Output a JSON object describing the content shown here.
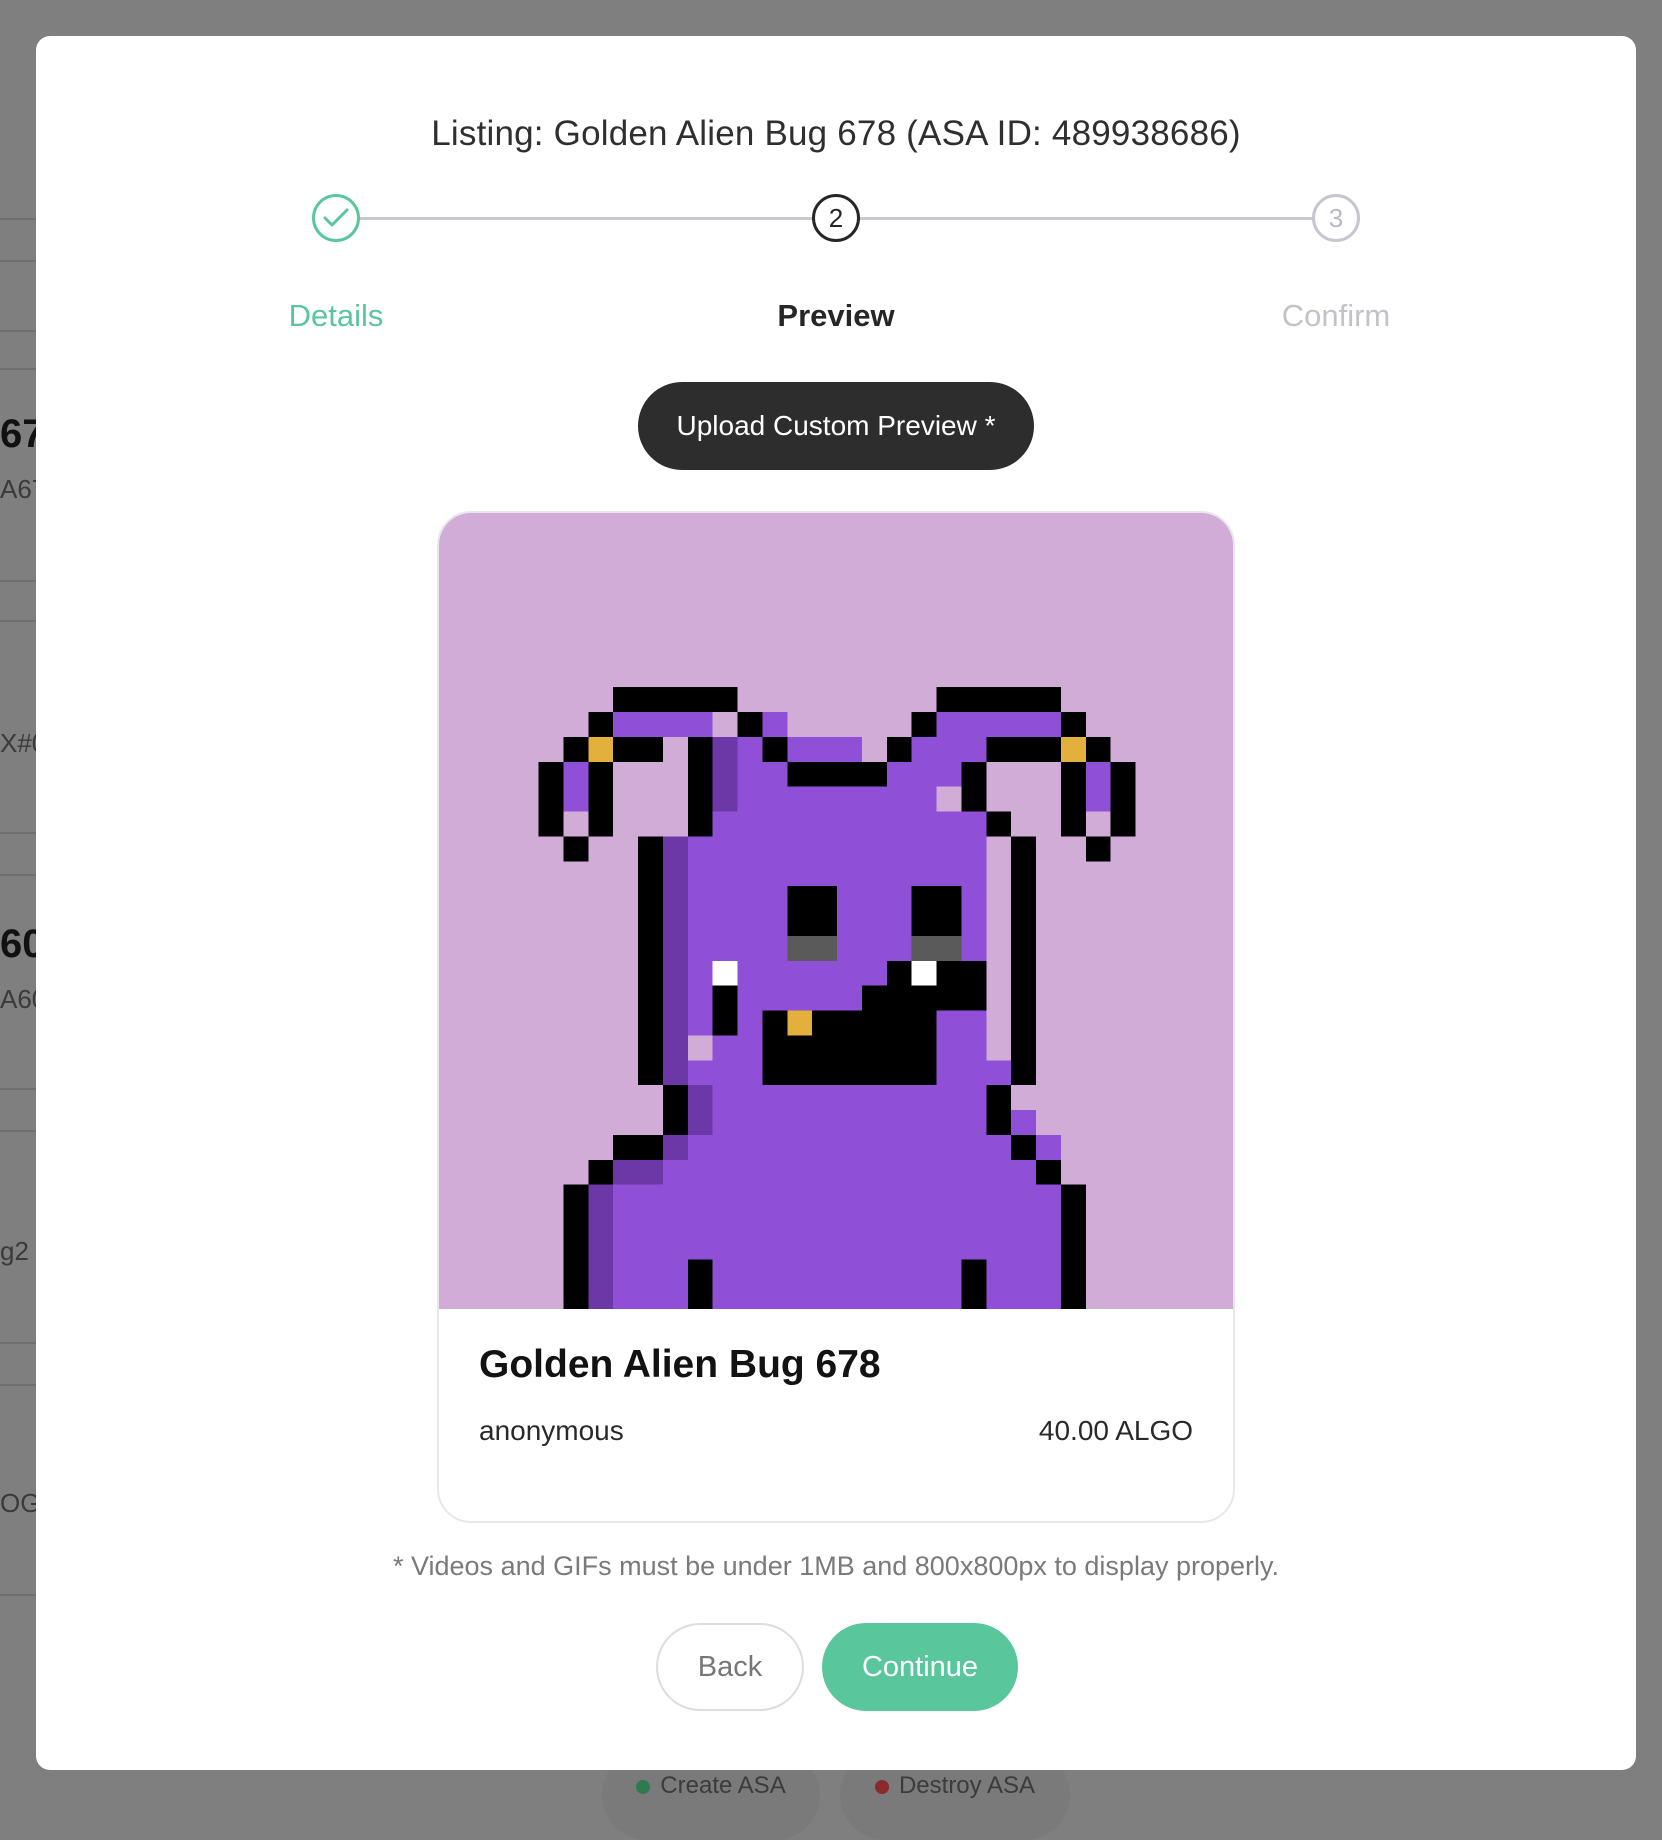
{
  "background": {
    "fragments": [
      "67",
      "A67",
      "X#0",
      "60",
      "A60",
      "g2",
      "OGE"
    ],
    "bottom_buttons": [
      "Create ASA",
      "Destroy ASA"
    ]
  },
  "modal": {
    "title": "Listing: Golden Alien Bug 678 (ASA ID: 489938686)",
    "steps": [
      {
        "number": "1",
        "label": "Details",
        "state": "done"
      },
      {
        "number": "2",
        "label": "Preview",
        "state": "active"
      },
      {
        "number": "3",
        "label": "Confirm",
        "state": "todo"
      }
    ],
    "upload_label": "Upload Custom Preview *",
    "card": {
      "name": "Golden Alien Bug 678",
      "creator": "anonymous",
      "price": "40.00 ALGO",
      "image_background": "#d0acd7",
      "body_color": "#8f4fd6"
    },
    "note": "* Videos and GIFs must be under 1MB and 800x800px to display properly.",
    "back_label": "Back",
    "continue_label": "Continue"
  },
  "colors": {
    "accent": "#5ac69c",
    "dark_button": "#2d2d2d",
    "overlay": "#7f7f7f"
  }
}
